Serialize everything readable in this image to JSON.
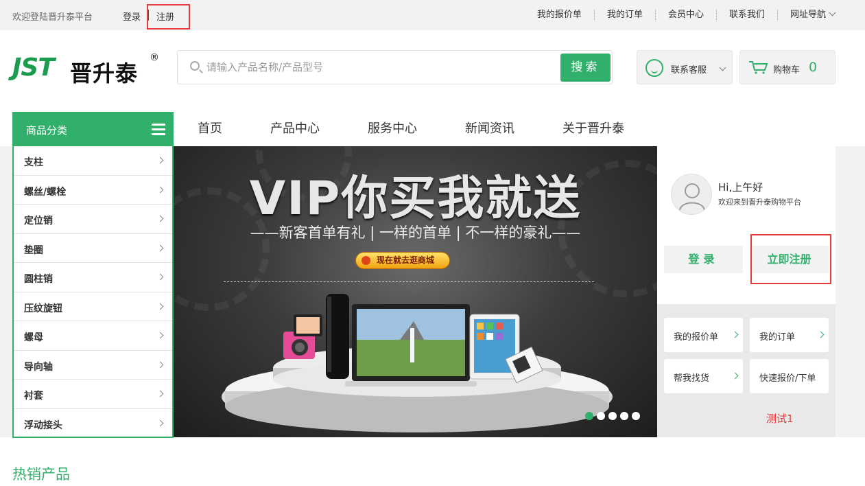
{
  "topbar": {
    "welcome": "欢迎登陆晋升泰平台",
    "login": "登录",
    "register": "注册",
    "links": [
      "我的报价单",
      "我的订单",
      "会员中心",
      "联系我们",
      "网址导航"
    ]
  },
  "header": {
    "logo_latin": "JST",
    "logo_cn": "晋升泰",
    "logo_reg": "®",
    "search_placeholder": "请输入产品名称/产品型号",
    "search_button": "搜索",
    "service_label": "联系客服",
    "cart_label": "购物车",
    "cart_count": "0"
  },
  "nav": {
    "category_title": "商品分类",
    "items": [
      "首页",
      "产品中心",
      "服务中心",
      "新闻资讯",
      "关于晋升泰"
    ]
  },
  "categories": [
    "支柱",
    "螺丝/螺栓",
    "定位销",
    "垫圈",
    "圆柱销",
    "压纹旋钮",
    "螺母",
    "导向轴",
    "衬套",
    "浮动接头"
  ],
  "banner": {
    "headline": "VIP你买我就送",
    "subline": "——新客首单有礼 | 一样的首单 | 不一样的豪礼——",
    "cta": "现在就去逛商城",
    "slide_count": 5,
    "active_slide": 1
  },
  "user_panel": {
    "greeting": "Hi,上午好",
    "welcome": "欢迎来到晋升泰购物平台",
    "login_button": "登录",
    "register_button": "立即注册"
  },
  "quick_links": [
    "我的报价单",
    "我的订单",
    "帮我找货",
    "快速报价/下单"
  ],
  "test_label": "测试1",
  "section_title": "热销产品",
  "colors": {
    "accent": "#31b06b",
    "highlight_box": "#e43b3b",
    "test_text": "#e43b3b"
  }
}
